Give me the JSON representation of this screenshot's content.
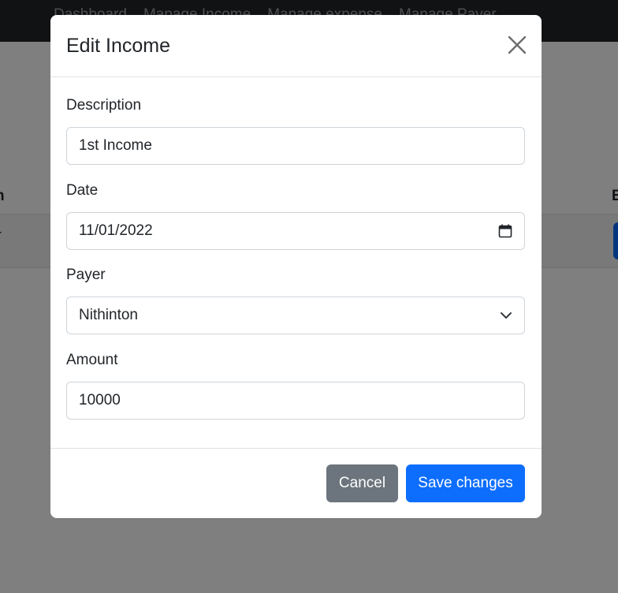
{
  "nav": {
    "links": [
      "Dashboard",
      "Manage Income",
      "Manage expense",
      "Manage Payer"
    ]
  },
  "background_table": {
    "header_left": "n",
    "header_right": "E",
    "row_cell": "-"
  },
  "modal": {
    "title": "Edit Income",
    "fields": {
      "description": {
        "label": "Description",
        "value": "1st Income"
      },
      "date": {
        "label": "Date",
        "value": "11/01/2022"
      },
      "payer": {
        "label": "Payer",
        "value": "Nithinton"
      },
      "amount": {
        "label": "Amount",
        "value": "10000"
      }
    },
    "cancel_label": "Cancel",
    "save_label": "Save changes"
  },
  "colors": {
    "primary": "#0d6efd",
    "secondary": "#6c757d",
    "navbar": "#212529"
  }
}
